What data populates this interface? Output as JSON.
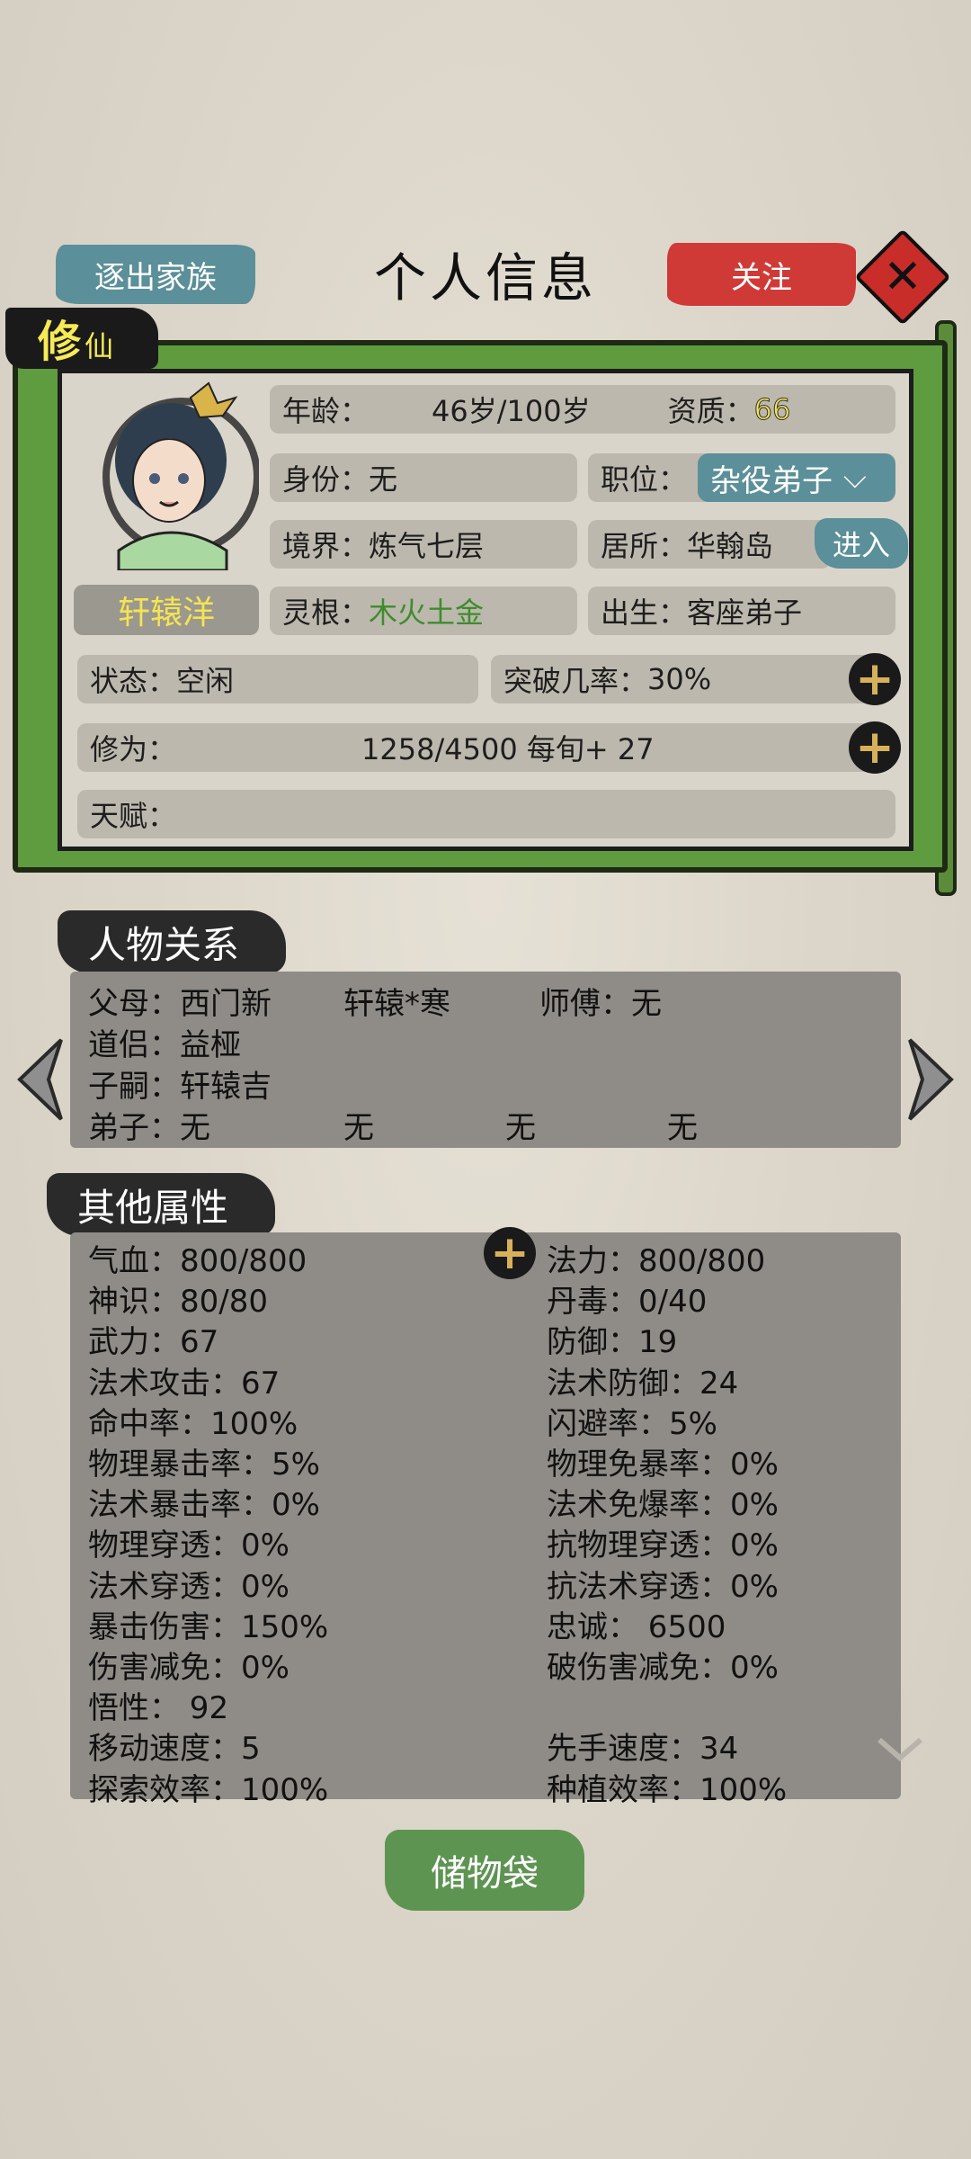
{
  "header": {
    "expel_label": "逐出家族",
    "title": "个人信息",
    "follow_label": "关注"
  },
  "profile": {
    "tag_big": "修",
    "tag_small": "仙",
    "name": "轩辕洋",
    "age_label": "年龄：",
    "age_value": "46岁/100岁",
    "aptitude_label": "资质：",
    "aptitude_value": "66",
    "identity_label": "身份：",
    "identity_value": "无",
    "position_label": "职位：",
    "position_value": "杂役弟子",
    "realm_label": "境界：",
    "realm_value": "炼气七层",
    "residence_label": "居所：",
    "residence_value": "华翰岛",
    "enter_label": "进入",
    "root_label": "灵根：",
    "root_value": "木火土金",
    "birth_label": "出生：",
    "birth_value": "客座弟子",
    "status_label": "状态：",
    "status_value": "空闲",
    "breakthrough_label": "突破几率：",
    "breakthrough_value": "30%",
    "cultivation_label": "修为：",
    "cultivation_value": "1258/4500  每旬+ 27",
    "talent_label": "天赋："
  },
  "relations": {
    "header": "人物关系",
    "parents_label": "父母：",
    "parent1": "西门新",
    "parent2": "轩辕*寒",
    "master_label": "师傅：",
    "master_value": "无",
    "partner_label": "道侣：",
    "partner_value": "益桠",
    "child_label": "子嗣：",
    "child_value": "轩辕吉",
    "disciple_label": "弟子：",
    "disciples": [
      "无",
      "无",
      "无",
      "无"
    ]
  },
  "attributes": {
    "header": "其他属性",
    "left": [
      "气血：800/800",
      "神识：80/80",
      "武力：67",
      "法术攻击：67",
      "命中率：100%",
      "物理暴击率：5%",
      "法术暴击率：0%",
      "物理穿透：0%",
      "法术穿透：0%",
      "暴击伤害：150%",
      "伤害减免：0%",
      "悟性：  92",
      "移动速度：5",
      "探索效率：100%"
    ],
    "right": [
      "法力：800/800",
      "丹毒：0/40",
      "防御：19",
      "法术防御：24",
      "闪避率：5%",
      "物理免暴率：0%",
      "法术免爆率：0%",
      "抗物理穿透：0%",
      "抗法术穿透：0%",
      "忠诚：  6500",
      "破伤害减免：0%",
      "",
      "先手速度：34",
      "种植效率：100%"
    ]
  },
  "footer": {
    "bag_label": "储物袋"
  },
  "colors": {
    "teal": "#5b8f99",
    "red": "#d03a36",
    "green_root": "#3e8c2c",
    "yellow": "#f4e451"
  }
}
